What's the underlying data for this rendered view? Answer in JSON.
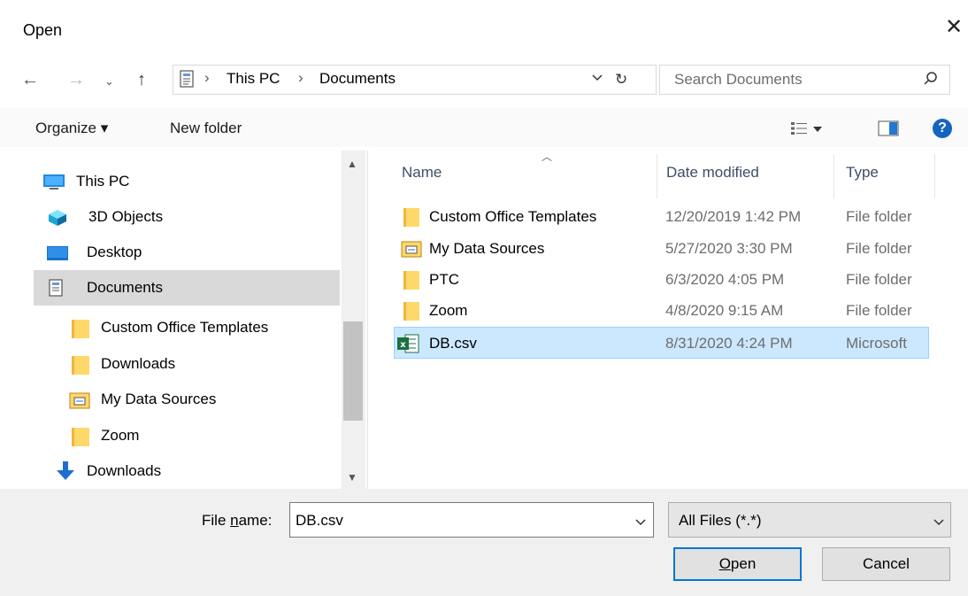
{
  "window": {
    "title": "Open"
  },
  "address": {
    "crumbs": [
      "This PC",
      "Documents"
    ]
  },
  "search": {
    "placeholder": "Search Documents"
  },
  "toolbar": {
    "organize_label": "Organize ▾",
    "new_folder_label": "New folder",
    "help_label": "?"
  },
  "nav": {
    "items": [
      {
        "label": "This PC",
        "icon": "pc-icon"
      },
      {
        "label": "3D Objects",
        "icon": "3d-objects-icon"
      },
      {
        "label": "Desktop",
        "icon": "desktop-icon"
      },
      {
        "label": "Documents",
        "icon": "documents-icon"
      },
      {
        "label": "Custom Office Templates",
        "icon": "folder-icon"
      },
      {
        "label": "Downloads",
        "icon": "folder-icon"
      },
      {
        "label": "My Data Sources",
        "icon": "data-sources-folder-icon"
      },
      {
        "label": "Zoom",
        "icon": "folder-icon"
      },
      {
        "label": "Downloads",
        "icon": "downloads-icon"
      }
    ]
  },
  "columns": {
    "name": "Name",
    "date": "Date modified",
    "type": "Type"
  },
  "files": [
    {
      "name": "Custom Office Templates",
      "date": "12/20/2019 1:42 PM",
      "type": "File folder",
      "icon": "folder-icon"
    },
    {
      "name": "My Data Sources",
      "date": "5/27/2020 3:30 PM",
      "type": "File folder",
      "icon": "data-sources-folder-icon"
    },
    {
      "name": "PTC",
      "date": "6/3/2020 4:05 PM",
      "type": "File folder",
      "icon": "folder-icon"
    },
    {
      "name": "Zoom",
      "date": "4/8/2020 9:15 AM",
      "type": "File folder",
      "icon": "folder-icon"
    },
    {
      "name": "DB.csv",
      "date": "8/31/2020 4:24 PM",
      "type": "Microsoft",
      "icon": "excel-file-icon"
    }
  ],
  "footer": {
    "file_name_label_pre": "File ",
    "file_name_label_u": "n",
    "file_name_label_post": "ame:",
    "file_name_value": "DB.csv",
    "file_type_value": "All Files (*.*)",
    "open_label_u": "O",
    "open_label_rest": "pen",
    "cancel_label": "Cancel"
  },
  "colors": {
    "accent": "#0078d7",
    "selected_bg": "#cce8ff",
    "folder": "#ffd86a"
  }
}
